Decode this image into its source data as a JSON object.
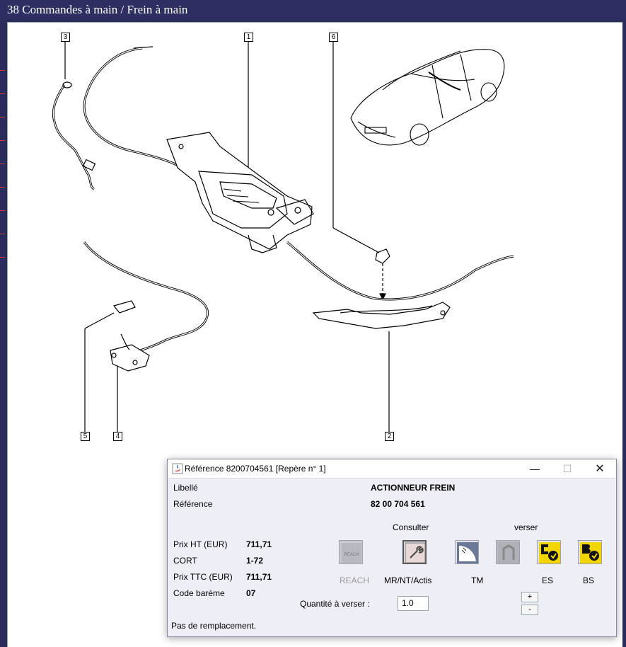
{
  "window": {
    "title": "38 Commandes à main / Frein à main"
  },
  "callouts": [
    "1",
    "2",
    "3",
    "4",
    "5",
    "6"
  ],
  "dialog": {
    "title": "Référence 8200704561 [Repère n° 1]",
    "libelle_label": "Libellé",
    "libelle_value": "ACTIONNEUR FREIN",
    "reference_label": "Référence",
    "reference_value": "82 00 704 561",
    "consulter_label": "Consulter",
    "verser_label": "verser",
    "prix_ht_label": "Prix HT (EUR)",
    "prix_ht_value": "711,71",
    "cort_label": "CORT",
    "cort_value": "1-72",
    "prix_ttc_label": "Prix TTC (EUR)",
    "prix_ttc_value": "711,71",
    "code_bareme_label": "Code barème",
    "code_bareme_value": "07",
    "buttons": {
      "reach": "REACH",
      "reach_icon_text": "REACH",
      "mr": "MR/NT/Actis",
      "tm": "TM",
      "es": "ES",
      "bs": "BS"
    },
    "quantite_label": "Quantité à verser :",
    "quantite_value": "1.0",
    "plus": "+",
    "minus": "-",
    "status": "Pas de remplacement."
  },
  "colors": {
    "frame": "#2b2b5c",
    "dialog_bg": "#eeeef6",
    "icon_yellow": "#f2d600"
  }
}
